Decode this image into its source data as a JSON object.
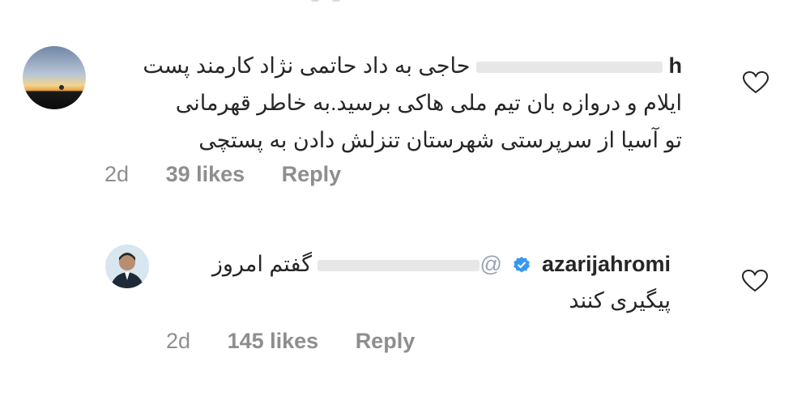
{
  "comments": [
    {
      "username": "h",
      "text_line1": "حاجی به داد حاتمی نژاد کارمند پست",
      "text_line2": "ایلام و دروازه بان تیم ملی هاکی برسید.به خاطر قهرمانی",
      "text_line3": "تو آسیا از سرپرستی شهرستان تنزلش دادن به پستچی",
      "time": "2d",
      "likes": "39 likes",
      "reply": "Reply"
    },
    {
      "username": "azarijahromi",
      "mention": "@",
      "text_line1": "گفتم امروز",
      "text_line2": "پیگیری کنند",
      "time": "2d",
      "likes": "145 likes",
      "reply": "Reply"
    }
  ],
  "icons": {
    "like": "heart-outline-icon",
    "verified": "verified-badge-icon"
  },
  "colors": {
    "text": "#262626",
    "meta": "#8e8e8e",
    "verified": "#3897f0",
    "mention": "#9aa3b2"
  }
}
